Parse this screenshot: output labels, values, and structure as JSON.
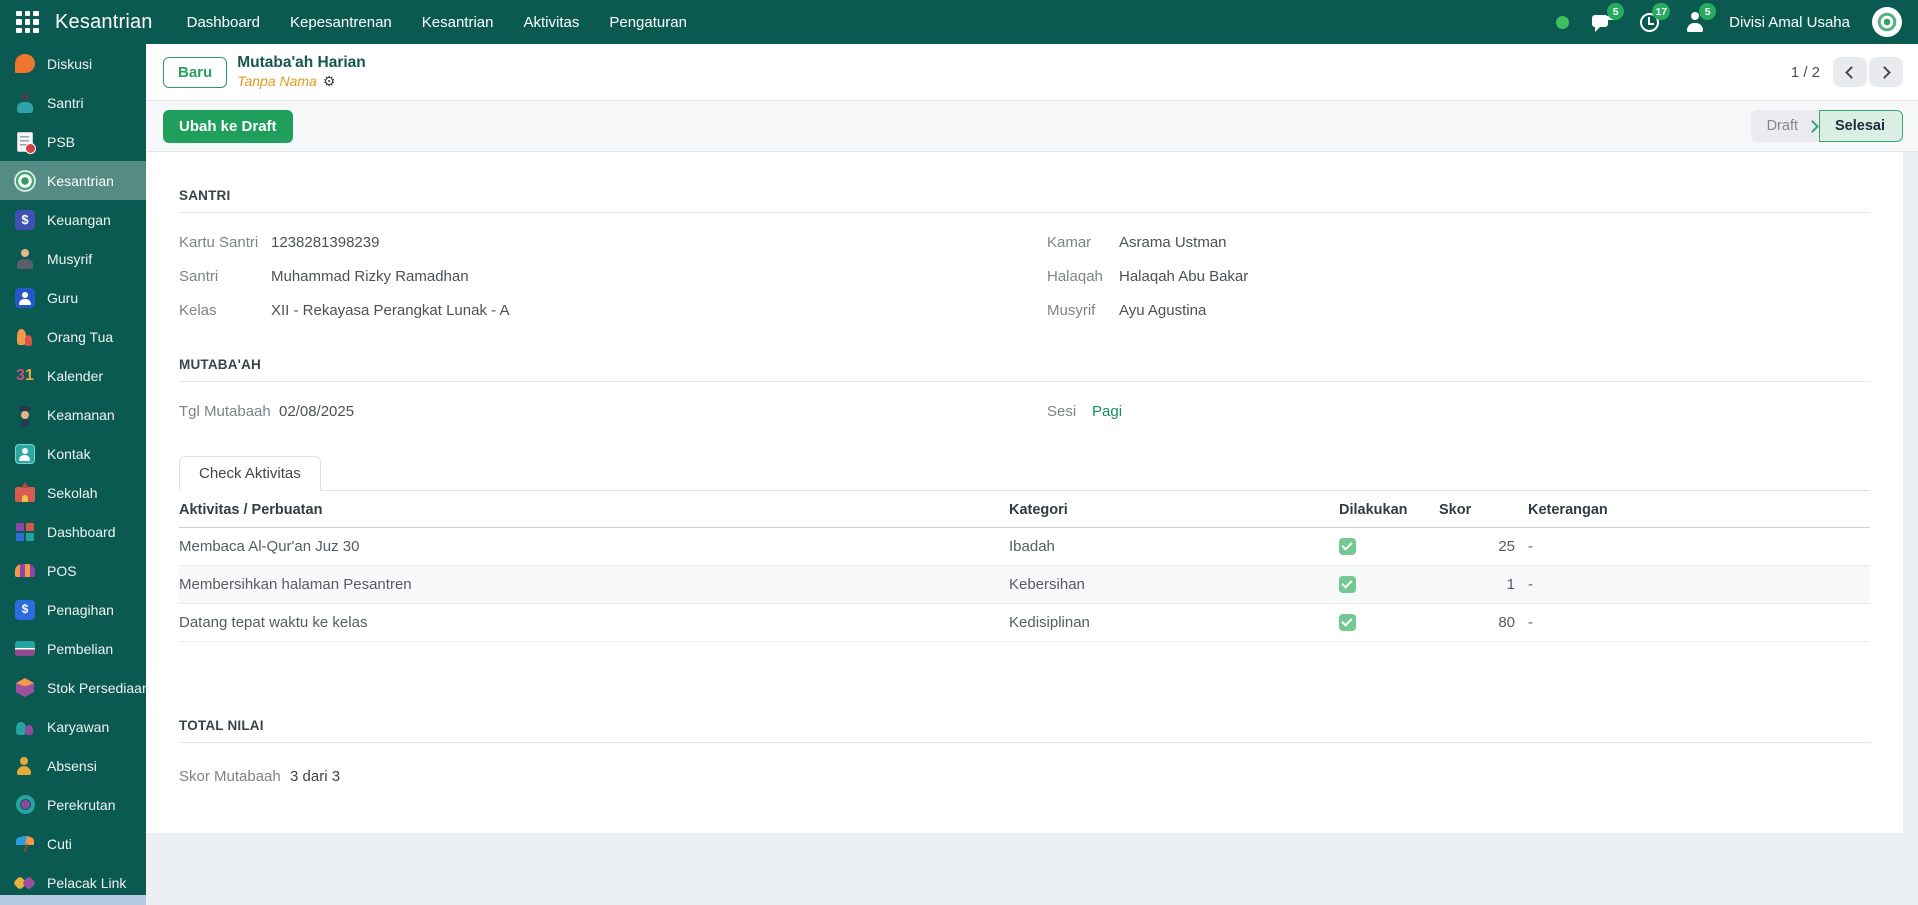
{
  "navbar": {
    "brand": "Kesantrian",
    "menus": [
      "Dashboard",
      "Kepesantrenan",
      "Kesantrian",
      "Aktivitas",
      "Pengaturan"
    ],
    "badges": {
      "messages": "5",
      "activities": "17",
      "requests": "5"
    },
    "user_name": "Divisi Amal Usaha"
  },
  "sidebar": {
    "items": [
      {
        "label": "Diskusi",
        "icon": "chat-bubble-icon"
      },
      {
        "label": "Santri",
        "icon": "student-icon"
      },
      {
        "label": "PSB",
        "icon": "registration-document-icon"
      },
      {
        "label": "Kesantrian",
        "icon": "pesantren-emblem-icon",
        "active": true
      },
      {
        "label": "Keuangan",
        "icon": "finance-dollar-icon"
      },
      {
        "label": "Musyrif",
        "icon": "mentor-person-icon"
      },
      {
        "label": "Guru",
        "icon": "teacher-icon"
      },
      {
        "label": "Orang Tua",
        "icon": "parents-icon"
      },
      {
        "label": "Kalender",
        "icon": "calendar-31-icon"
      },
      {
        "label": "Keamanan",
        "icon": "security-guard-icon"
      },
      {
        "label": "Kontak",
        "icon": "contacts-icon"
      },
      {
        "label": "Sekolah",
        "icon": "school-building-icon"
      },
      {
        "label": "Dashboard",
        "icon": "dashboard-grid-icon"
      },
      {
        "label": "POS",
        "icon": "pos-shop-icon"
      },
      {
        "label": "Penagihan",
        "icon": "invoicing-icon"
      },
      {
        "label": "Pembelian",
        "icon": "purchase-icon"
      },
      {
        "label": "Stok Persediaan",
        "icon": "inventory-box-icon"
      },
      {
        "label": "Karyawan",
        "icon": "employees-icon"
      },
      {
        "label": "Absensi",
        "icon": "attendance-icon"
      },
      {
        "label": "Perekrutan",
        "icon": "recruitment-icon"
      },
      {
        "label": "Cuti",
        "icon": "time-off-umbrella-icon"
      },
      {
        "label": "Pelacak Link",
        "icon": "link-tracker-icon"
      }
    ]
  },
  "control_panel": {
    "new_button": "Baru",
    "title": "Mutaba'ah Harian",
    "record_name": "Tanpa Nama",
    "pager": "1 / 2"
  },
  "statusbar": {
    "action": "Ubah ke Draft",
    "draft": "Draft",
    "done": "Selesai"
  },
  "form": {
    "santri": {
      "heading": "SANTRI",
      "left": [
        {
          "label": "Kartu Santri",
          "value": "1238281398239"
        },
        {
          "label": "Santri",
          "value": "Muhammad Rizky Ramadhan"
        },
        {
          "label": "Kelas",
          "value": "XII - Rekayasa Perangkat Lunak - A"
        }
      ],
      "right": [
        {
          "label": "Kamar",
          "value": "Asrama Ustman"
        },
        {
          "label": "Halaqah",
          "value": "Halaqah Abu Bakar"
        },
        {
          "label": "Musyrif",
          "value": "Ayu Agustina"
        }
      ]
    },
    "mutabaah": {
      "heading": "MUTABA'AH",
      "tgl_label": "Tgl Mutabaah",
      "tgl_value": "02/08/2025",
      "sesi_label": "Sesi",
      "sesi_value": "Pagi"
    },
    "tab": "Check Aktivitas",
    "table": {
      "headers": [
        "Aktivitas / Perbuatan",
        "Kategori",
        "Dilakukan",
        "Skor",
        "Keterangan"
      ],
      "rows": [
        {
          "aktivitas": "Membaca Al-Qur'an Juz 30",
          "kategori": "Ibadah",
          "dilakukan": true,
          "skor": "25",
          "keterangan": "-"
        },
        {
          "aktivitas": "Membersihkan halaman Pesantren",
          "kategori": "Kebersihan",
          "dilakukan": true,
          "skor": "1",
          "keterangan": "-"
        },
        {
          "aktivitas": "Datang tepat waktu ke kelas",
          "kategori": "Kedisiplinan",
          "dilakukan": true,
          "skor": "80",
          "keterangan": "-"
        }
      ]
    },
    "total": {
      "heading": "TOTAL NILAI",
      "label": "Skor Mutabaah",
      "value": "3 dari 3"
    }
  },
  "colors": {
    "navbar_teal": "#0b5a51",
    "action_green": "#1f9f5b",
    "link_green": "#158f62",
    "record_name_orange": "#e59a1b",
    "checkbox_green": "#74c894",
    "status_done_bg": "#d9efe3"
  }
}
